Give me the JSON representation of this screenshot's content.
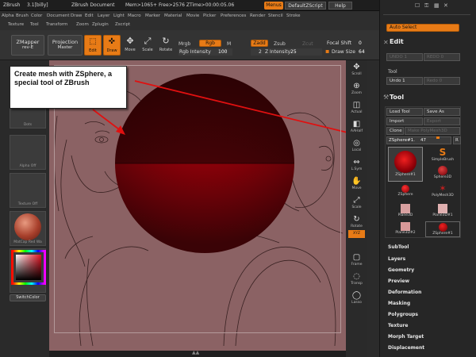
{
  "titlebar": {
    "app": "ZBrush",
    "version": "3.1[billy]",
    "document": "ZBrush Document",
    "mem": "Mem>1065+ Free>2576 ZTime>00:00:05.06",
    "menus_label": "Menus",
    "script_label": "DefaultZScript",
    "help_label": "Help"
  },
  "menubar": {
    "row1": [
      "Alpha",
      "Brush",
      "Color",
      "Document",
      "Draw",
      "Edit",
      "Layer",
      "Light",
      "Macro",
      "Marker",
      "Material",
      "Movie",
      "Picker",
      "Preferences",
      "Render",
      "Stencil",
      "Stroke"
    ],
    "row2": [
      "Texture",
      "Tool",
      "Transform",
      "Zoom",
      "Zplugin",
      "Zscript"
    ]
  },
  "shelf": {
    "zmapper": "ZMapper",
    "zmapper_sub": "rev-E",
    "projection": "Projection",
    "projection_sub": "Master",
    "edit": "Edit",
    "draw": "Draw",
    "move": "Move",
    "scale": "Scale",
    "rotate": "Rotate",
    "mrgb": "Mrgb",
    "rgb": "Rgb",
    "m": "M",
    "rgb_intensity_label": "Rgb Intensity",
    "rgb_intensity_value": "100",
    "zadd": "Zadd",
    "zsub": "Zsub",
    "zcut": "Zcut",
    "z_intensity_label": "Z Intensity",
    "z_intensity_value": "25",
    "focal_shift_label": "Focal Shift",
    "focal_shift_value": "0",
    "draw_size_label": "Draw Size",
    "draw_size_value": "64",
    "z_num": "2"
  },
  "leftpanel": {
    "dots_label": "Dots",
    "alpha_label": "Alpha Off",
    "texture_label": "Texture Off",
    "material_label": "MatCap Red Wa",
    "switch_color": "SwitchColor"
  },
  "callout": {
    "line1": "Create mesh with ZSphere, a",
    "line2": "special tool of ZBrush"
  },
  "rightstrip": [
    {
      "name": "scroll",
      "label": "Scroll",
      "glyph": "✥"
    },
    {
      "name": "zoom",
      "label": "Zoom",
      "glyph": "⊕"
    },
    {
      "name": "actual",
      "label": "Actual",
      "glyph": "◫"
    },
    {
      "name": "aahalf",
      "label": "AAHalf",
      "glyph": "◧"
    },
    {
      "name": "local",
      "label": "Local",
      "glyph": "◎"
    },
    {
      "name": "lsym",
      "label": "L.Sym",
      "glyph": "⇔"
    },
    {
      "name": "move",
      "label": "Move",
      "glyph": "✋"
    },
    {
      "name": "scale",
      "label": "Scale",
      "glyph": "⤢"
    },
    {
      "name": "rotate",
      "label": "Rotate",
      "glyph": "↻"
    },
    {
      "name": "xyz",
      "label": "XYZ",
      "glyph": ""
    },
    {
      "name": "frame",
      "label": "Frame",
      "glyph": "▢"
    },
    {
      "name": "transp",
      "label": "Transp",
      "glyph": "◌"
    },
    {
      "name": "lasso",
      "label": "Lasso",
      "glyph": "◯"
    }
  ],
  "rightpanel": {
    "auto_select": "Auto Select",
    "edit_header": "Edit",
    "undo1": "UNDO 1",
    "redo0": "REDO 0",
    "tool_sub": "Tool",
    "undo_btn": "Undo 1",
    "redo_btn": "Redo 0",
    "tool_header": "Tool",
    "load_tool": "Load Tool",
    "save_as": "Save As",
    "import": "Import",
    "export": "Export",
    "clone": "Clone",
    "make_polymesh": "Make PolyMesh3D",
    "current_tool": "ZSphere#1.",
    "current_num": "47",
    "r_btn": "R",
    "tools": [
      {
        "name": "zsphere1",
        "label": "ZSphere#1"
      },
      {
        "name": "simplebrush",
        "label": "SimpleBrush"
      },
      {
        "name": "sphere3d",
        "label": "Sphere3D"
      },
      {
        "name": "zsphere",
        "label": "ZSphere"
      },
      {
        "name": "polymesh3d",
        "label": "PolyMesh3D"
      },
      {
        "name": "plane3d",
        "label": "Plane3D"
      },
      {
        "name": "plane3d1",
        "label": "Plane3D#1"
      },
      {
        "name": "plane3d2",
        "label": "Plane3D#2"
      },
      {
        "name": "zsphere1b",
        "label": "ZSphere#1"
      }
    ],
    "subpalettes": [
      "SubTool",
      "Layers",
      "Geometry",
      "Preview",
      "Deformation",
      "Masking",
      "Polygroups",
      "Texture",
      "Morph Target",
      "Displacement"
    ]
  },
  "colors": {
    "accent": "#e87b16",
    "canvas": "#8b6264",
    "sphere_dark": "#4a0408",
    "sphere_red": "#c4000c"
  }
}
